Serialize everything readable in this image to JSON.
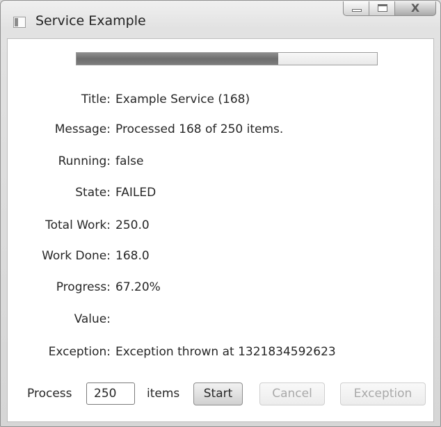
{
  "window": {
    "title": "Service Example"
  },
  "titlebar_buttons": {
    "minimize_icon": "minimize-icon",
    "maximize_icon": "maximize-icon",
    "close_glyph": "X"
  },
  "progress": {
    "fraction": 0.672
  },
  "properties": [
    {
      "label": "Title:",
      "value": "Example Service (168)"
    },
    {
      "label": "Message:",
      "value": "Processed 168 of 250 items."
    },
    {
      "label": "Running:",
      "value": "false"
    },
    {
      "label": "State:",
      "value": "FAILED"
    },
    {
      "label": "Total Work:",
      "value": "250.0"
    },
    {
      "label": "Work Done:",
      "value": "168.0"
    },
    {
      "label": "Progress:",
      "value": "67.20%"
    },
    {
      "label": "Value:",
      "value": ""
    },
    {
      "label": "Exception:",
      "value": "Exception thrown at 1321834592623"
    }
  ],
  "controls": {
    "process_label": "Process",
    "items_value": "250",
    "items_label": "items",
    "start_label": "Start",
    "cancel_label": "Cancel",
    "exception_label": "Exception"
  }
}
